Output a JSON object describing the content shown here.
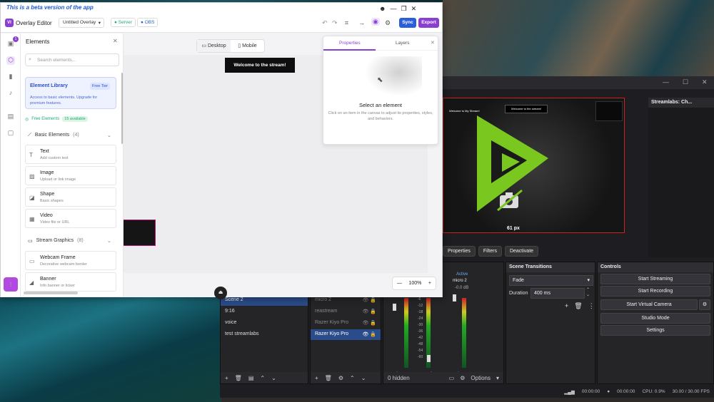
{
  "editor": {
    "beta_banner": "This is a beta version of the app",
    "app_name": "Overlay Editor",
    "logo_text": "VI",
    "overlay_name": "Untitled Overlay",
    "server_label": "Server",
    "obs_label": "OBS",
    "sync_label": "Sync",
    "export_label": "Export",
    "rail_badge": "1"
  },
  "elements_panel": {
    "title": "Elements",
    "search_placeholder": "Search elements...",
    "library": {
      "title": "Element Library",
      "badge": "Free Tier",
      "desc": "Access to basic elements. Upgrade for premium features."
    },
    "free_elements_label": "Free Elements",
    "free_count": "15 available",
    "sections": [
      {
        "name": "Basic Elements",
        "count": "(4)"
      },
      {
        "name": "Stream Graphics",
        "count": "(8)"
      }
    ],
    "basic_items": [
      {
        "name": "Text",
        "desc": "Add custom text"
      },
      {
        "name": "Image",
        "desc": "Upload or link image"
      },
      {
        "name": "Shape",
        "desc": "Basic shapes"
      },
      {
        "name": "Video",
        "desc": "Video file or URL"
      }
    ],
    "graphics_items": [
      {
        "name": "Webcam Frame",
        "desc": "Decorative webcam border"
      },
      {
        "name": "Banner",
        "desc": "Info banner or ticker"
      }
    ]
  },
  "canvas": {
    "desktop_label": "Desktop",
    "mobile_label": "Mobile",
    "title_text": "Welcome to the stream!",
    "zoom": "100%"
  },
  "properties": {
    "tab_properties": "Properties",
    "tab_layers": "Layers",
    "empty_title": "Select an element",
    "empty_desc": "Click on an item in the canvas to adjust its properties, styles, and behaviors."
  },
  "obs": {
    "preview_title_left": "Welcome to My Stream!",
    "preview_title_mid": "Welcome to the stream!",
    "size_label": "61 px",
    "right_dock_title": "Streamlabs: Ch...",
    "toolbar": [
      "Properties",
      "Filters",
      "Deactivate"
    ],
    "scenes": [
      "Scene 2",
      "9:16",
      "voice",
      "test streamlabs"
    ],
    "sources": [
      {
        "name": "micro 2",
        "active": false
      },
      {
        "name": "reastream",
        "active": false
      },
      {
        "name": "Razer Kiyo Pro",
        "active": false
      },
      {
        "name": "Razer Kiyo Pro",
        "active": true
      }
    ],
    "mixer": {
      "active_label": "Active",
      "channel_name": "micro 2",
      "db_value": "-0.0 dB",
      "hidden_label": "0 hidden",
      "options_label": "Options",
      "scale": [
        "-6",
        "-12",
        "-18",
        "-24",
        "-30",
        "-36",
        "-42",
        "-48",
        "-54",
        "-60"
      ]
    },
    "transitions": {
      "title": "Scene Transitions",
      "type": "Fade",
      "duration_label": "Duration",
      "duration_value": "400 ms"
    },
    "controls": {
      "title": "Controls",
      "buttons": [
        "Start Streaming",
        "Start Recording",
        "Start Virtual Camera",
        "Studio Mode",
        "Settings"
      ]
    },
    "status": {
      "rec_time": "00:00:00",
      "stream_time": "00:00:00",
      "cpu": "CPU: 0.9%",
      "fps": "30.00 / 30.00 FPS"
    }
  },
  "colors": {
    "accent": "#8b3fd1",
    "sync_blue": "#2b5fd9",
    "obs_bg": "#1e1e22",
    "logo_green": "#7ac81f"
  }
}
